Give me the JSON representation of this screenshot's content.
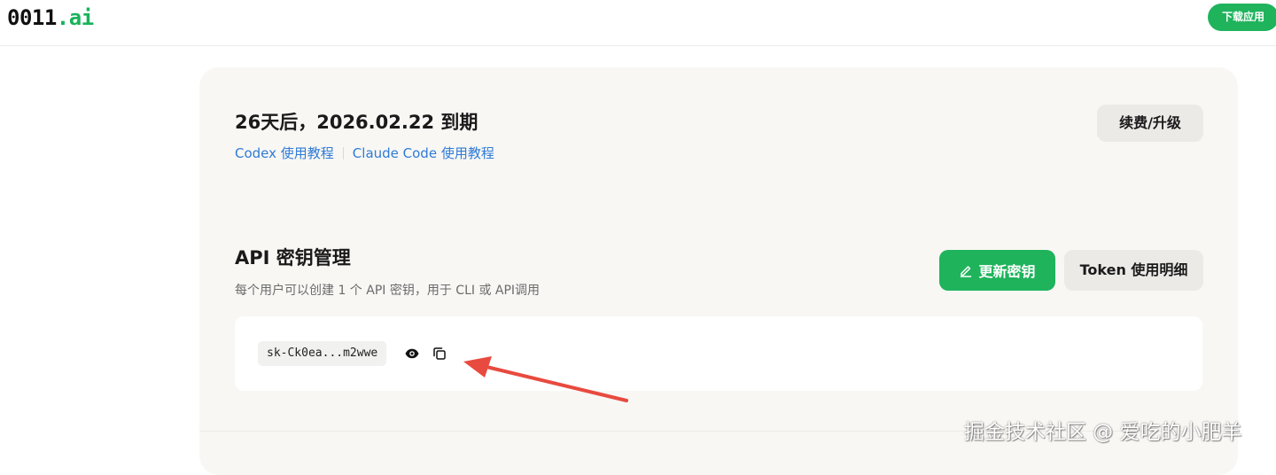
{
  "header": {
    "logo_main": "0011",
    "logo_accent": ".ai",
    "download_label": "下载应用"
  },
  "subscription": {
    "expiry_text": "26天后，2026.02.22 到期",
    "tutorials": [
      {
        "label": "Codex 使用教程"
      },
      {
        "label": "Claude Code 使用教程"
      }
    ],
    "renew_label": "续费/升级"
  },
  "api": {
    "title": "API 密钥管理",
    "description": "每个用户可以创建 1 个 API 密钥，用于 CLI 或 API调用",
    "update_label": "更新密钥",
    "token_label": "Token 使用明细",
    "key_masked": "sk-Ck0ea...m2wwe",
    "icons": [
      "pencil-icon",
      "eye-icon",
      "copy-icon"
    ]
  },
  "watermark": "掘金技术社区 @ 爱吃的小肥羊",
  "colors": {
    "accent_green": "#1fb35c",
    "link_blue": "#2f7bd6",
    "arrow_red": "#e84a3f"
  }
}
